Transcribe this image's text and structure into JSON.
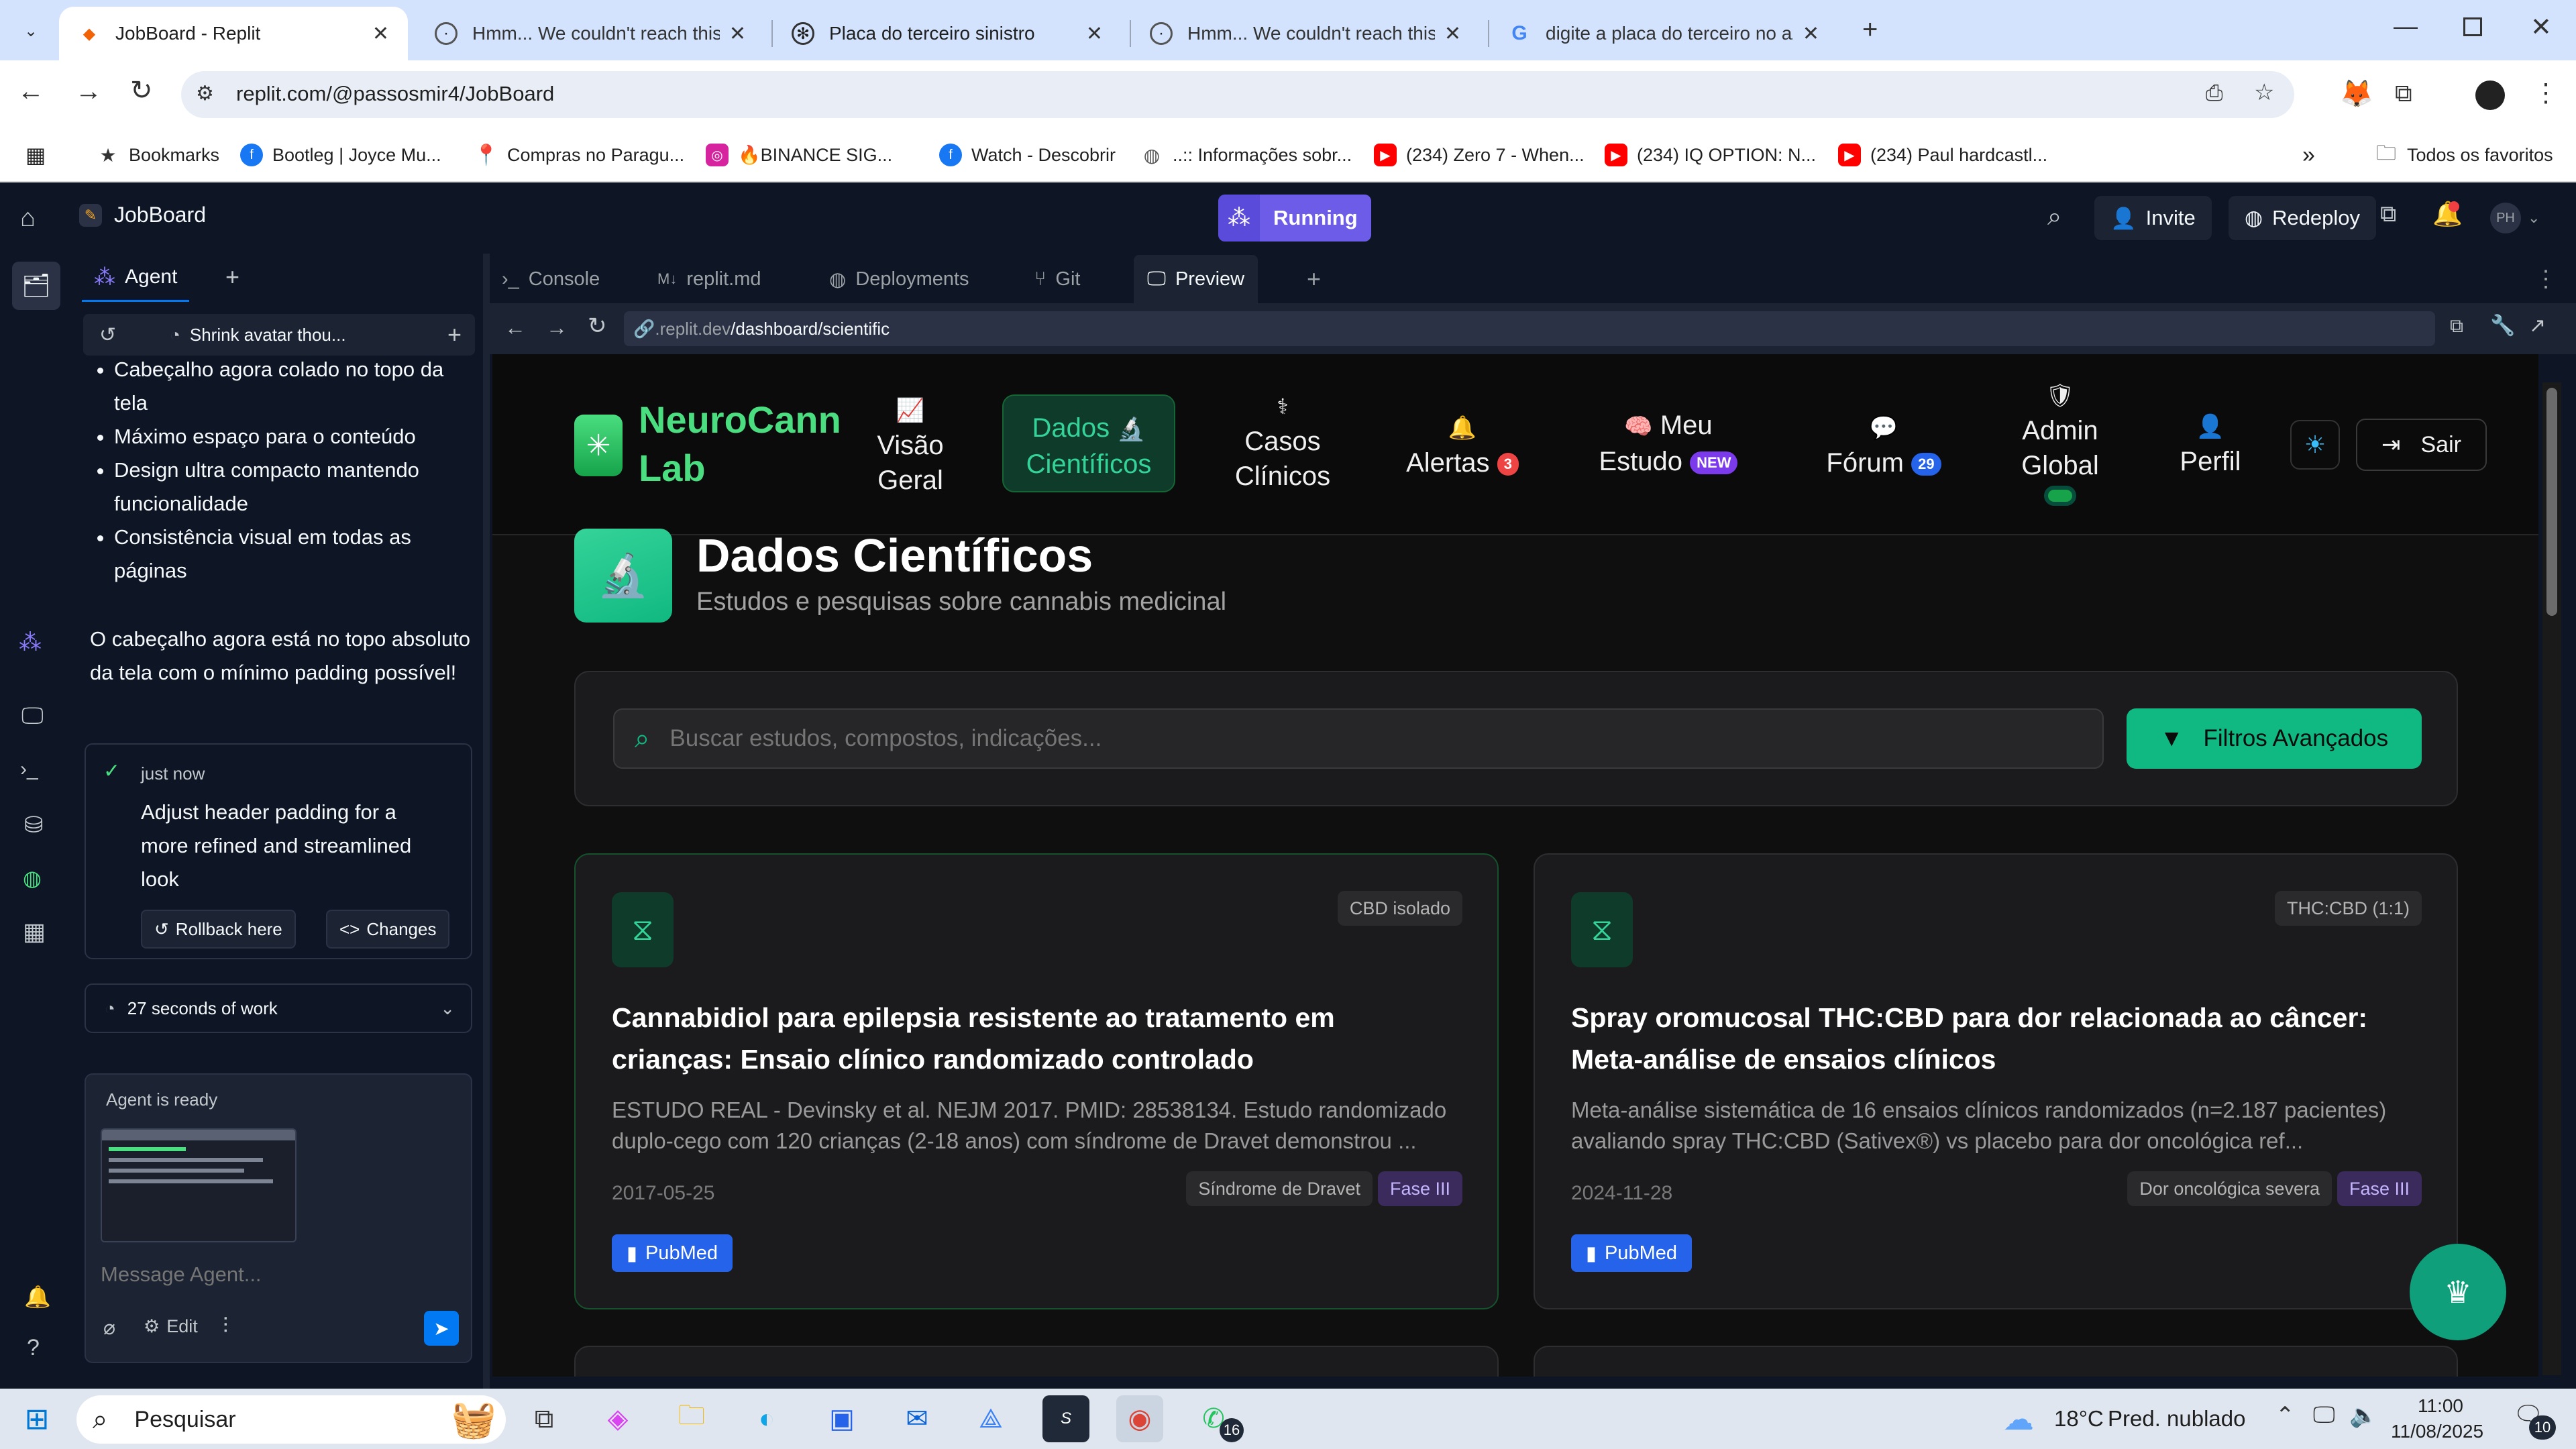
{
  "browser": {
    "tabs": [
      {
        "title": "JobBoard - Replit",
        "active": true
      },
      {
        "title": "Hmm... We couldn't reach this a"
      },
      {
        "title": "Placa do terceiro sinistro"
      },
      {
        "title": "Hmm... We couldn't reach this a"
      },
      {
        "title": "digite a placa do terceiro no az"
      }
    ],
    "url": "replit.com/@passosmir4/JobBoard",
    "bookmarks": [
      "Bookmarks",
      "Bootleg | Joyce Mu...",
      "Compras no Paragu...",
      "🔥BINANCE SIG...",
      "Watch - Descobrir",
      "..:: Informações sobr...",
      "(234) Zero 7 - When...",
      "(234) IQ OPTION: N...",
      "(234) Paul hardcastl..."
    ],
    "all_bookmarks": "Todos os favoritos"
  },
  "replit": {
    "repl_name": "JobBoard",
    "status": "Running",
    "invite": "Invite",
    "redeploy": "Redeploy",
    "avatar_initials": "PH",
    "pane_tabs": {
      "agent": "Agent",
      "console": "Console",
      "readme": "replit.md",
      "deployments": "Deployments",
      "git": "Git",
      "preview": "Preview"
    },
    "preview_url_prefix": ".replit.dev",
    "preview_url_path": "/dashboard/scientific"
  },
  "agent": {
    "thread_title": "Shrink avatar thou...",
    "bullets": [
      "Cabeçalho agora colado no topo da tela",
      "Máximo espaço para o conteúdo",
      "Design ultra compacto mantendo funcionalidade",
      "Consistência visual em todas as páginas"
    ],
    "summary": "O cabeçalho agora está no topo absoluto da tela com o mínimo padding possível!",
    "checkpoint_time": "just now",
    "checkpoint_text": "Adjust header padding for a more refined and streamlined look",
    "rollback": "Rollback here",
    "changes": "Changes",
    "work_time": "27 seconds of work",
    "ready": "Agent is ready",
    "placeholder": "Message Agent...",
    "edit": "Edit"
  },
  "app": {
    "brand_line1": "NeuroCann",
    "brand_line2": "Lab",
    "nav": [
      {
        "line1": "Visão",
        "line2": "Geral",
        "icon": "chart-line-icon"
      },
      {
        "line1": "Dados",
        "line2": "Científicos",
        "icon": "microscope-icon",
        "active": true
      },
      {
        "line1": "Casos",
        "line2": "Clínicos",
        "icon": "doctor-icon"
      },
      {
        "line1": "Alertas",
        "badge": "3",
        "icon": "bell-icon"
      },
      {
        "line1": "Meu",
        "line2": "Estudo",
        "badge": "NEW",
        "icon": "brain-icon"
      },
      {
        "line1": "Fórum",
        "badge": "29",
        "icon": "chat-icon"
      },
      {
        "line1": "Admin",
        "line2": "Global",
        "icon": "shield-icon"
      },
      {
        "line1": "Perfil",
        "icon": "user-icon"
      }
    ],
    "logout": "Sair",
    "page_title": "Dados Científicos",
    "page_subtitle": "Estudos e pesquisas sobre cannabis medicinal",
    "search_placeholder": "Buscar estudos, compostos, indicações...",
    "filters_button": "Filtros Avançados",
    "studies": [
      {
        "compound": "CBD isolado",
        "title": "Cannabidiol para epilepsia resistente ao tratamento em crianças: Ensaio clínico randomizado controlado",
        "desc": "ESTUDO REAL - Devinsky et al. NEJM 2017. PMID: 28538134. Estudo randomizado duplo-cego com 120 crianças (2-18 anos) com síndrome de Dravet demonstrou ...",
        "date": "2017-05-25",
        "condition": "Síndrome de Dravet",
        "phase": "Fase III",
        "source": "PubMed"
      },
      {
        "compound": "THC:CBD (1:1)",
        "title": "Spray oromucosal THC:CBD para dor relacionada ao câncer: Meta-análise de ensaios clínicos",
        "desc": "Meta-análise sistemática de 16 ensaios clínicos randomizados (n=2.187 pacientes) avaliando spray THC:CBD (Sativex®) vs placebo para dor oncológica ref...",
        "date": "2024-11-28",
        "condition": "Dor oncológica severa",
        "phase": "Fase III",
        "source": "PubMed"
      }
    ]
  },
  "taskbar": {
    "search": "Pesquisar",
    "weather_temp": "18°C",
    "weather_desc": "Pred. nublado",
    "time": "11:00",
    "date": "11/08/2025",
    "whatsapp_badge": "16",
    "notif_badge": "10"
  },
  "colors": {
    "accent_green": "#10b981",
    "replit_purple": "#5b4bdb",
    "pubmed_blue": "#2563eb",
    "phase_purple": "#a78bfa"
  }
}
